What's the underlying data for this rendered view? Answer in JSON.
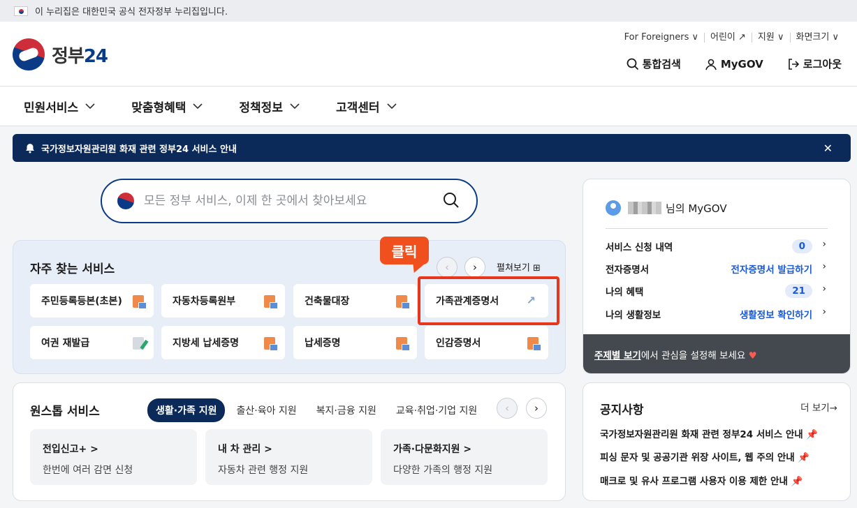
{
  "banner": {
    "text": "이 누리집은 대한민국 공식 전자정부 누리집입니다."
  },
  "header": {
    "logo_text": "정부",
    "logo_num": "24",
    "util": [
      "For Foreigners ∨",
      "어린이 ↗",
      "지원 ∨",
      "화면크기 ∨"
    ],
    "actions": {
      "search": "통합검색",
      "mygov": "MyGOV",
      "logout": "로그아웃"
    }
  },
  "nav": {
    "items": [
      "민원서비스",
      "맞춤형혜택",
      "정책정보",
      "고객센터"
    ]
  },
  "alert": {
    "text": "국가정보자원관리원 화재 관련 정부24 서비스 안내"
  },
  "search": {
    "placeholder": "모든 정부 서비스, 이제 한 곳에서 찾아보세요"
  },
  "frequent": {
    "title": "자주 찾는 서비스",
    "expand": "펼쳐보기 ⊞",
    "callout": "클릭",
    "items": [
      "주민등록등본(초본)",
      "자동차등록원부",
      "건축물대장",
      "가족관계증명서",
      "여권 재발급",
      "지방세 납세증명",
      "납세증명",
      "인감증명서"
    ]
  },
  "onestop": {
    "title": "원스톱 서비스",
    "tabs": [
      "생활·가족 지원",
      "출산·육아 지원",
      "복지·금융 지원",
      "교육·취업·기업 지원"
    ],
    "cards": [
      {
        "title": "전입신고+ >",
        "desc": "한번에 여러 감면 신청"
      },
      {
        "title": "내 차 관리 >",
        "desc": "자동차 관련 행정 지원"
      },
      {
        "title": "가족·다문화지원 >",
        "desc": "다양한 가족의 행정 지원"
      }
    ]
  },
  "mygov": {
    "suffix": "님의 MyGOV",
    "rows": [
      {
        "label": "서비스 신청 내역",
        "value": "0"
      },
      {
        "label": "전자증명서",
        "value": "전자증명서 발급하기"
      },
      {
        "label": "나의 혜택",
        "value": "21"
      },
      {
        "label": "나의 생활정보",
        "value": "생활정보 확인하기"
      }
    ],
    "footer_link": "주제별 보기",
    "footer_text": "에서 관심을 설정해 보세요"
  },
  "notice": {
    "title": "공지사항",
    "more": "더 보기→",
    "items": [
      "국가정보자원관리원 화재 관련 정부24 서비스 안내",
      "피싱 문자 및 공공기관 위장 사이트, 웹 주의 안내",
      "매크로 및 유사 프로그램 사용자 이용 제한 안내"
    ]
  }
}
